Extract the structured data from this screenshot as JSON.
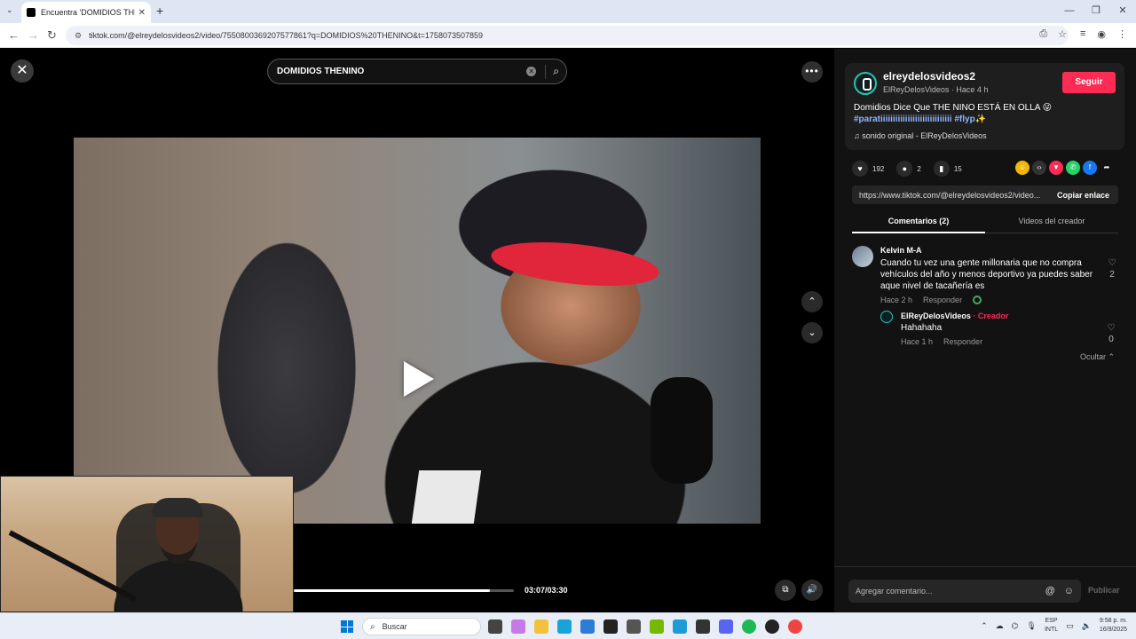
{
  "browser": {
    "tab_title": "Encuentra 'DOMIDIOS THENINO'",
    "url": "tiktok.com/@elreydelosvideos2/video/7550800369207577861?q=DOMIDIOS%20THENINO&t=1758073507859"
  },
  "video": {
    "search_query": "DOMIDIOS THENINO",
    "time": "03:07/03:30",
    "progress": 0.89
  },
  "post": {
    "username": "elreydelosvideos2",
    "subline": "ElReyDelosVideos · Hace 4 h",
    "follow_label": "Seguir",
    "description": "Domidios Dice Que THE NINO ESTÁ EN OLLA 😜",
    "hashtags": "#paratiiiiiiiiiiiiiiiiiiiiiiiiiiiii #flyp✨",
    "sound": "sonido original - ElReyDelosVideos",
    "likes": "192",
    "comments": "2",
    "saves": "15",
    "link": "https://www.tiktok.com/@elreydelosvideos2/video...",
    "copy_label": "Copiar enlace"
  },
  "tabs": {
    "comments": "Comentarios (2)",
    "creator_videos": "Videos del creador"
  },
  "comment": {
    "author": "Kelvin M-A",
    "text": "Cuando tu vez una gente millonaria que no compra vehículos del año y menos deportivo ya puedes saber aque nivel de tacañería es",
    "time": "Hace 2 h",
    "reply_label": "Responder",
    "likes": "2"
  },
  "reply": {
    "author": "ElReyDelosVideos",
    "creator_tag": " · Creador",
    "text": "Hahahaha",
    "time": "Hace 1 h",
    "reply_label": "Responder",
    "likes": "0"
  },
  "hide_label": "Ocultar ⌃",
  "composer": {
    "placeholder": "Agregar comentario...",
    "publish_label": "Publicar"
  },
  "taskbar": {
    "search_placeholder": "Buscar",
    "lang_top": "ESP",
    "lang_bottom": "INTL",
    "time": "9:58 p. m.",
    "date": "16/9/2025"
  },
  "colors": {
    "accent": "#fe2c55",
    "hashtag": "#8fb6ff"
  }
}
